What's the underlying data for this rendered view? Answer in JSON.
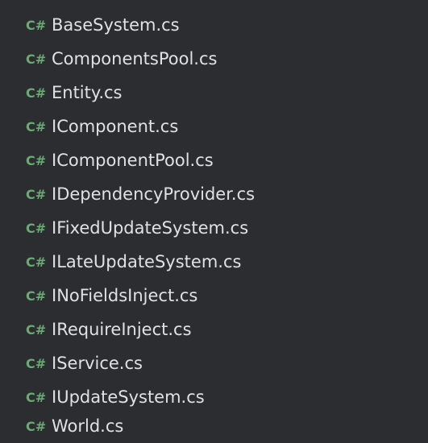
{
  "colors": {
    "background": "#2b2d30",
    "icon": "#6aab73",
    "text": "#dfe1e5"
  },
  "file_list": {
    "icon_text": "C#",
    "icon_name": "csharp-file-icon",
    "items": [
      {
        "name": "BaseSystem.cs"
      },
      {
        "name": "ComponentsPool.cs"
      },
      {
        "name": "Entity.cs"
      },
      {
        "name": "IComponent.cs"
      },
      {
        "name": "IComponentPool.cs"
      },
      {
        "name": "IDependencyProvider.cs"
      },
      {
        "name": "IFixedUpdateSystem.cs"
      },
      {
        "name": "ILateUpdateSystem.cs"
      },
      {
        "name": "INoFieldsInject.cs"
      },
      {
        "name": "IRequireInject.cs"
      },
      {
        "name": "IService.cs"
      },
      {
        "name": "IUpdateSystem.cs"
      },
      {
        "name": "World.cs"
      }
    ]
  }
}
